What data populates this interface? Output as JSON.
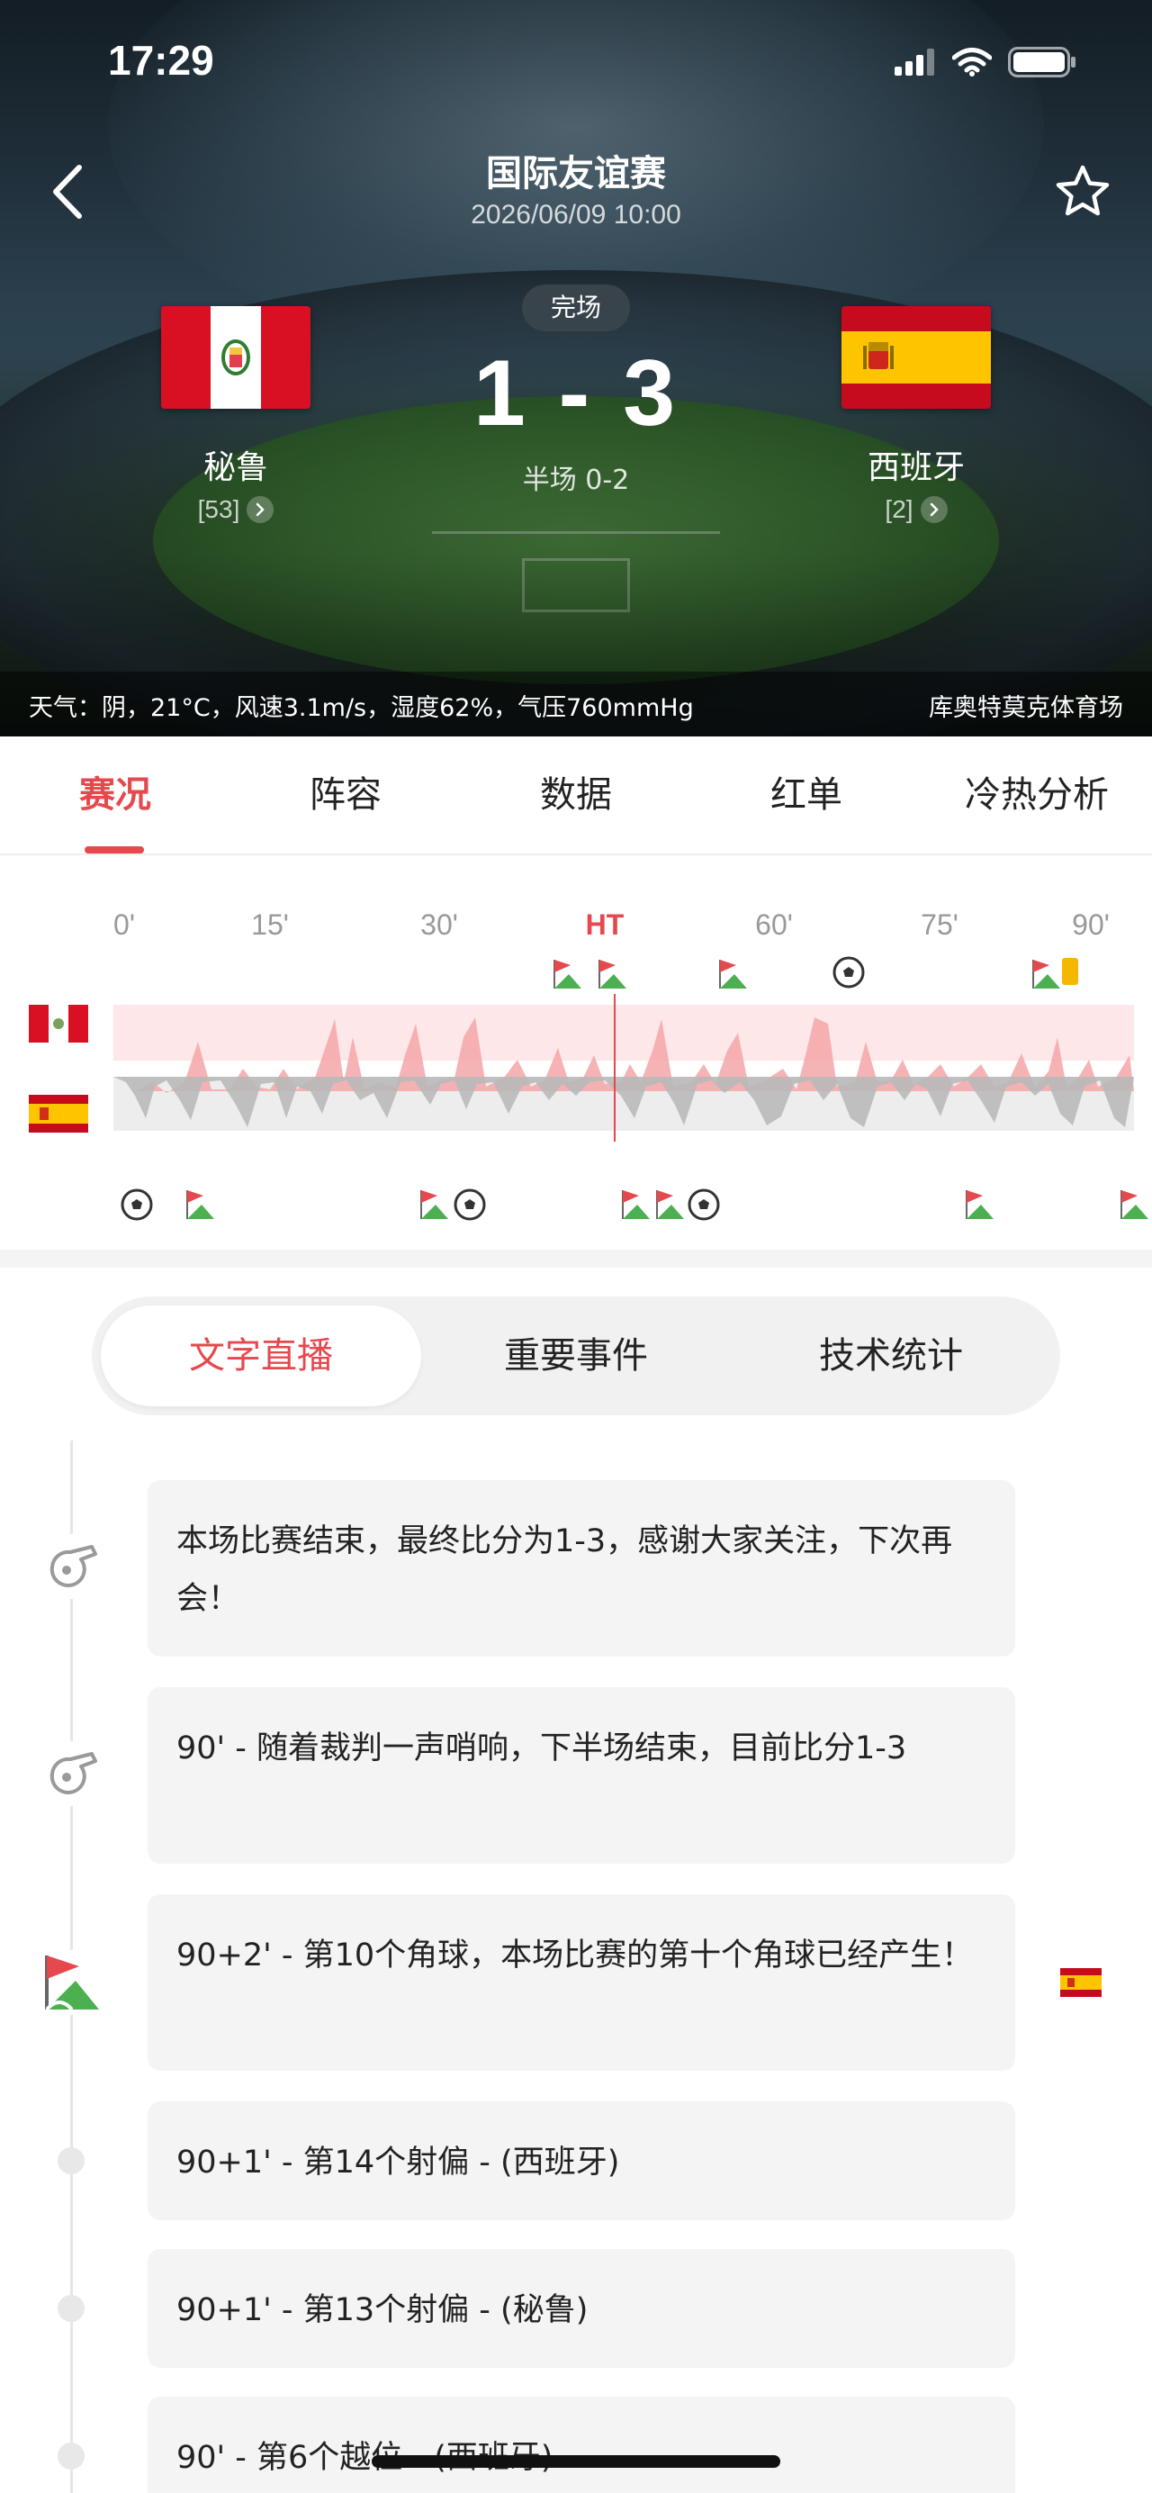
{
  "status_bar": {
    "time": "17:29"
  },
  "header": {
    "competition": "国际友谊赛",
    "datetime": "2026/06/09 10:00",
    "status": "完场",
    "score": "1 - 3",
    "halftime": "半场 0-2",
    "home": {
      "name": "秘鲁",
      "rank": "[53]"
    },
    "away": {
      "name": "西班牙",
      "rank": "[2]"
    },
    "weather": "天气：阴，21°C，风速3.1m/s，湿度62%，气压760mmHg",
    "venue": "库奥特莫克体育场"
  },
  "tabs": [
    "赛况",
    "阵容",
    "数据",
    "红单",
    "冷热分析"
  ],
  "momentum": {
    "minute_labels": [
      "0'",
      "15'",
      "30'",
      "HT",
      "60'",
      "75'",
      "90'"
    ]
  },
  "segments": [
    "文字直播",
    "重要事件",
    "技术统计"
  ],
  "timeline": [
    {
      "text": "本场比赛结束，最终比分为1-3，感谢大家关注，下次再会！",
      "icon": "whistle-icon"
    },
    {
      "text": "90' - 随着裁判一声哨响，下半场结束，目前比分1-3",
      "icon": "whistle-icon"
    },
    {
      "text": "90+2' - 第10个角球，本场比赛的第十个角球已经产生！",
      "icon": "corner-flag-icon",
      "team": "away"
    },
    {
      "text": "90+1' - 第14个射偏 - (西班牙)",
      "icon": "dot"
    },
    {
      "text": "90+1' - 第13个射偏 - (秘鲁)",
      "icon": "dot"
    },
    {
      "text": "90' - 第6个越位 - (西班牙)",
      "icon": "dot"
    }
  ],
  "colors": {
    "accent": "#e5484d",
    "peru_red": "#d91023",
    "spain_red": "#c60b1e",
    "spain_yellow": "#ffc400"
  }
}
